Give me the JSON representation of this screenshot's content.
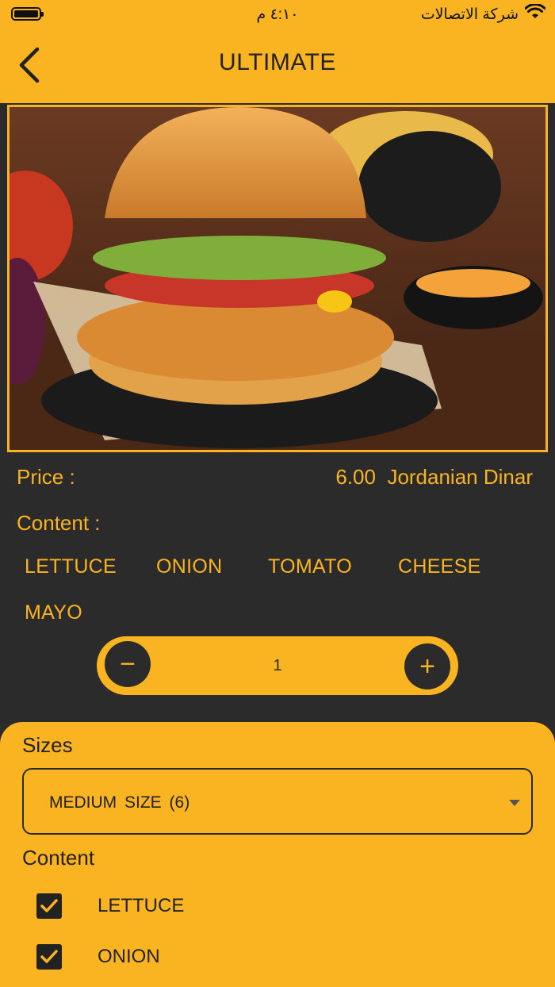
{
  "status_bar": {
    "time": "٤:١٠ م",
    "carrier": "شركة الاتصالات"
  },
  "header": {
    "title": "ULTIMATE"
  },
  "product": {
    "price_label": "Price :",
    "price_value": "6.00",
    "currency": "Jordanian Dinar",
    "content_label": "Content :",
    "ingredients": [
      "LETTUCE",
      "ONION",
      "TOMATO",
      "CHEESE",
      "MAYO"
    ]
  },
  "quantity": {
    "value": "1",
    "minus": "−",
    "plus": "+"
  },
  "sheet": {
    "sizes_heading": "Sizes",
    "selected_size": "MEDIUM SIZE",
    "selected_size_count": "(6)",
    "content_heading": "Content",
    "options": [
      {
        "label": "LETTUCE",
        "checked": true
      },
      {
        "label": "ONION",
        "checked": true
      }
    ]
  },
  "colors": {
    "accent": "#fbb421",
    "background": "#2b2b2b"
  },
  "icons": [
    "battery-icon",
    "wifi-icon",
    "back-chevron-icon",
    "minus-icon",
    "plus-icon",
    "dropdown-arrow-icon",
    "checkmark-icon"
  ]
}
